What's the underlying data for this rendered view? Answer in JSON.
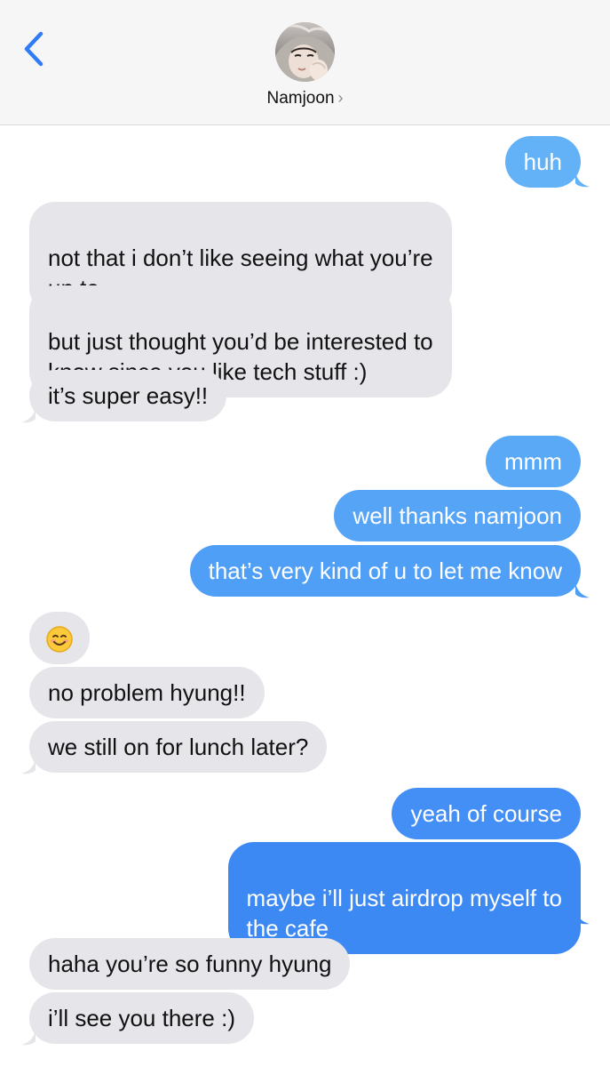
{
  "header": {
    "contact_name": "Namjoon",
    "chevron": "›"
  },
  "messages": [
    {
      "side": "sent",
      "text": "huh",
      "color": "#63b2f7"
    },
    {
      "side": "recv",
      "text": "not that i don’t like seeing what you’re\nup to"
    },
    {
      "side": "recv",
      "text": "but just thought you’d be interested to\nknow since you like tech stuff :)"
    },
    {
      "side": "recv",
      "text": "it’s super easy!!"
    },
    {
      "side": "sent",
      "text": "mmm",
      "color": "#5aa9f6"
    },
    {
      "side": "sent",
      "text": "well thanks namjoon",
      "color": "#56a4f6"
    },
    {
      "side": "sent",
      "text": "that’s very kind of u to let me know",
      "color": "#4f9ff6"
    },
    {
      "side": "recv",
      "text": "😊",
      "emoji": "smiling-face-icon"
    },
    {
      "side": "recv",
      "text": "no problem hyung!!"
    },
    {
      "side": "recv",
      "text": "we still on for lunch later?"
    },
    {
      "side": "sent",
      "text": "yeah of course",
      "color": "#438ff5"
    },
    {
      "side": "sent",
      "text": "maybe i’ll just airdrop myself to\nthe cafe",
      "color": "#3d89f3"
    },
    {
      "side": "recv",
      "text": "haha you’re so funny hyung"
    },
    {
      "side": "recv",
      "text": "i’ll see you there :)"
    }
  ]
}
